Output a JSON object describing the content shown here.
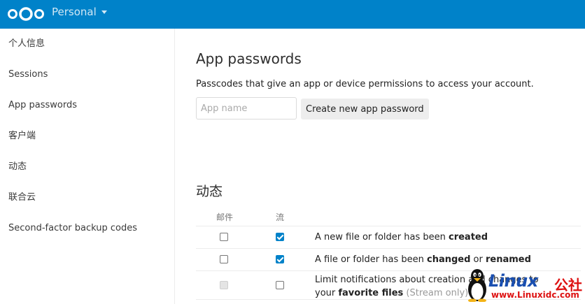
{
  "header": {
    "app_menu_label": "Personal"
  },
  "sidebar": {
    "items": [
      {
        "label": "个人信息"
      },
      {
        "label": "Sessions"
      },
      {
        "label": "App passwords"
      },
      {
        "label": "客户端"
      },
      {
        "label": "动态"
      },
      {
        "label": "联合云"
      },
      {
        "label": "Second-factor backup codes"
      }
    ]
  },
  "app_passwords": {
    "title": "App passwords",
    "description": "Passcodes that give an app or device permissions to access your account.",
    "input_placeholder": "App name",
    "input_value": "",
    "create_button": "Create new app password"
  },
  "activity": {
    "title": "动态",
    "col_mail": "邮件",
    "col_stream": "流",
    "rows": [
      {
        "mail_checked": false,
        "stream_checked": true,
        "text_before": "A new file or folder has been ",
        "bold1": "created"
      },
      {
        "mail_checked": false,
        "stream_checked": true,
        "text_before": "A file or folder has been ",
        "bold1": "changed",
        "text_mid": " or ",
        "bold2": "renamed"
      },
      {
        "mail_disabled": true,
        "stream_checked": false,
        "text_before": "Limit notifications about creation and changes to your ",
        "bold1": "favorite files",
        "muted": " (Stream only)"
      }
    ]
  },
  "watermark": {
    "brand": "Linux",
    "brand_cn": "公社",
    "url": "www.Linuxidc.com"
  },
  "colors": {
    "header_bg": "#0082c9",
    "checkbox_checked": "#0082c9"
  }
}
